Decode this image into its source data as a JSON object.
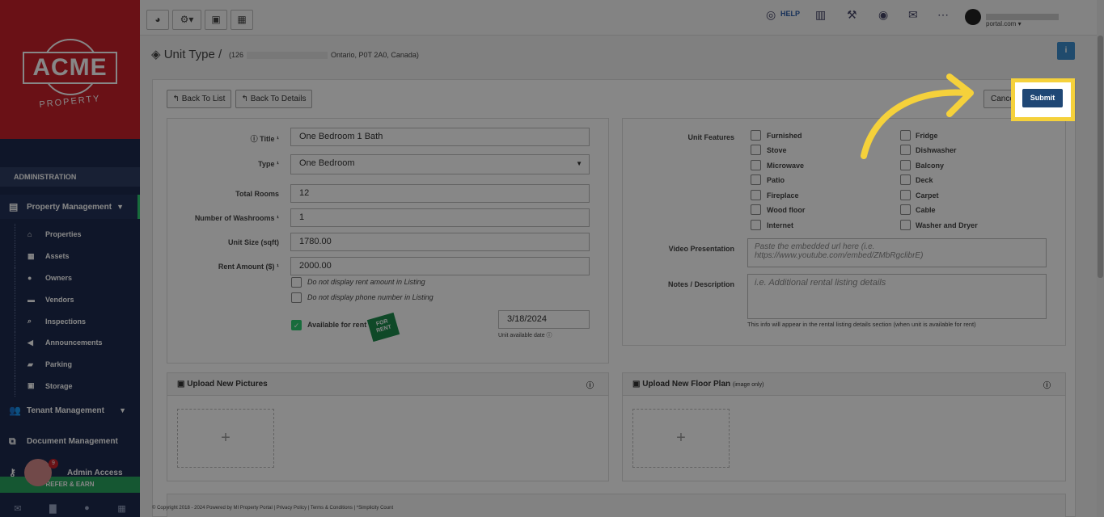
{
  "logo": {
    "name": "ACME",
    "sub": "PROPERTY"
  },
  "sidebar": {
    "admin_label": "ADMINISTRATION",
    "sections": [
      {
        "label": "Property Management",
        "icon": "building-icon"
      },
      {
        "label": "Tenant Management",
        "icon": "users-icon"
      },
      {
        "label": "Document Management",
        "icon": "documents-icon"
      },
      {
        "label": "Admin Access",
        "icon": "key-icon"
      }
    ],
    "items": [
      {
        "label": "Properties",
        "icon": "home-icon"
      },
      {
        "label": "Assets",
        "icon": "list-icon"
      },
      {
        "label": "Owners",
        "icon": "user-icon"
      },
      {
        "label": "Vendors",
        "icon": "briefcase-icon"
      },
      {
        "label": "Inspections",
        "icon": "search-icon"
      },
      {
        "label": "Announcements",
        "icon": "bullhorn-icon"
      },
      {
        "label": "Parking",
        "icon": "car-icon"
      },
      {
        "label": "Storage",
        "icon": "archive-icon"
      }
    ],
    "refer_label": "REFER & EARN",
    "badge": "9"
  },
  "topbar": {
    "help": "HELP",
    "email_suffix": "portal.com"
  },
  "page": {
    "title": "Unit Type /",
    "address_prefix": "(126",
    "address_suffix": "Ontario, P0T 2A0, Canada)",
    "info": "i"
  },
  "buttons": {
    "back_list": "Back To List",
    "back_details": "Back To Details",
    "cancel": "Cancel",
    "submit": "Submit"
  },
  "form": {
    "title_label": "Title",
    "title_value": "One Bedroom 1 Bath",
    "type_label": "Type",
    "type_value": "One Bedroom",
    "rooms_label": "Total Rooms",
    "rooms_value": "12",
    "washrooms_label": "Number of Washrooms",
    "washrooms_value": "1",
    "size_label": "Unit Size (sqft)",
    "size_value": "1780.00",
    "rent_label": "Rent Amount ($)",
    "rent_value": "2000.00",
    "no_rent_display": "Do not display rent amount in Listing",
    "no_phone_display": "Do not display phone number in Listing",
    "available_label": "Available for rent",
    "date_value": "3/18/2024",
    "date_note": "Unit available date",
    "sign_text": "FOR RENT"
  },
  "features": {
    "label": "Unit Features",
    "left": [
      "Furnished",
      "Stove",
      "Microwave",
      "Patio",
      "Fireplace",
      "Wood floor",
      "Internet"
    ],
    "right": [
      "Fridge",
      "Dishwasher",
      "Balcony",
      "Deck",
      "Carpet",
      "Cable",
      "Washer and Dryer"
    ]
  },
  "video": {
    "label": "Video Presentation",
    "placeholder": "Paste the embedded url here (i.e. https://www.youtube.com/embed/ZMbRgclibrE)"
  },
  "notes": {
    "label": "Notes / Description",
    "placeholder": "i.e. Additional rental listing details",
    "hint": "This info will appear in the rental listing details section (when unit is available for rent)"
  },
  "uploads": {
    "pictures": "Upload New Pictures",
    "floor_plan": "Upload New Floor Plan",
    "floor_plan_note": "(image only)",
    "plus": "+"
  },
  "footer": "© Copyright 2018 - 2024 Powered by MI Property Portal | Privacy Policy | Terms & Conditions | *Simplicity Count"
}
